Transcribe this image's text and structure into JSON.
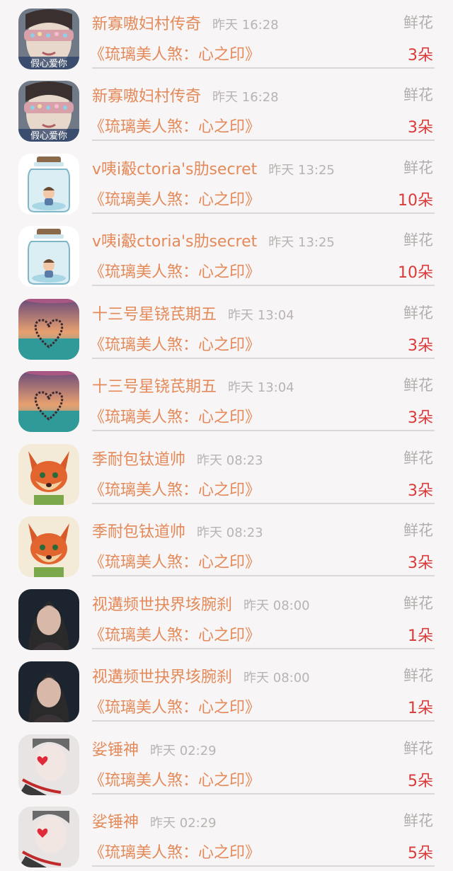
{
  "list": {
    "items": [
      {
        "sender": "新寡嗷妇村传奇",
        "time": "昨天 16:28",
        "gift_label": "鲜花",
        "book": "《琉璃美人煞：心之印》",
        "count": "3朵",
        "avatar": "mask-girl-avatar"
      },
      {
        "sender": "新寡嗷妇村传奇",
        "time": "昨天 16:28",
        "gift_label": "鲜花",
        "book": "《琉璃美人煞：心之印》",
        "count": "3朵",
        "avatar": "mask-girl-avatar"
      },
      {
        "sender": "v咦i觳ctoria's肋secret",
        "time": "昨天 13:25",
        "gift_label": "鲜花",
        "book": "《琉璃美人煞：心之印》",
        "count": "10朵",
        "avatar": "jar-avatar"
      },
      {
        "sender": "v咦i觳ctoria's肋secret",
        "time": "昨天 13:25",
        "gift_label": "鲜花",
        "book": "《琉璃美人煞：心之印》",
        "count": "10朵",
        "avatar": "jar-avatar"
      },
      {
        "sender": "十三号星铙芪期五",
        "time": "昨天 13:04",
        "gift_label": "鲜花",
        "book": "《琉璃美人煞：心之印》",
        "count": "3朵",
        "avatar": "heart-sunset-avatar"
      },
      {
        "sender": "十三号星铙芪期五",
        "time": "昨天 13:04",
        "gift_label": "鲜花",
        "book": "《琉璃美人煞：心之印》",
        "count": "3朵",
        "avatar": "heart-sunset-avatar"
      },
      {
        "sender": "季耐包钛道帅",
        "time": "昨天 08:23",
        "gift_label": "鲜花",
        "book": "《琉璃美人煞：心之印》",
        "count": "3朵",
        "avatar": "fox-avatar"
      },
      {
        "sender": "季耐包钛道帅",
        "time": "昨天 08:23",
        "gift_label": "鲜花",
        "book": "《琉璃美人煞：心之印》",
        "count": "3朵",
        "avatar": "fox-avatar"
      },
      {
        "sender": "视遘频世抉界垓腕刹",
        "time": "昨天 08:00",
        "gift_label": "鲜花",
        "book": "《琉璃美人煞：心之印》",
        "count": "1朵",
        "avatar": "woman-portrait-avatar"
      },
      {
        "sender": "视遘频世抉界垓腕刹",
        "time": "昨天 08:00",
        "gift_label": "鲜花",
        "book": "《琉璃美人煞：心之印》",
        "count": "1朵",
        "avatar": "woman-portrait-avatar"
      },
      {
        "sender": "娑锤神",
        "time": "昨天 02:29",
        "gift_label": "鲜花",
        "book": "《琉璃美人煞：心之印》",
        "count": "5朵",
        "avatar": "heart-girl-avatar"
      },
      {
        "sender": "娑锤神",
        "time": "昨天 02:29",
        "gift_label": "鲜花",
        "book": "《琉璃美人煞：心之印》",
        "count": "5朵",
        "avatar": "heart-girl-avatar"
      }
    ]
  },
  "colors": {
    "name": "#e48a5a",
    "count": "#d93a3a",
    "muted": "#b3aeae",
    "background": "#f7f5f5"
  },
  "avatar_captions": {
    "mask-girl-avatar": "假心爱你"
  }
}
